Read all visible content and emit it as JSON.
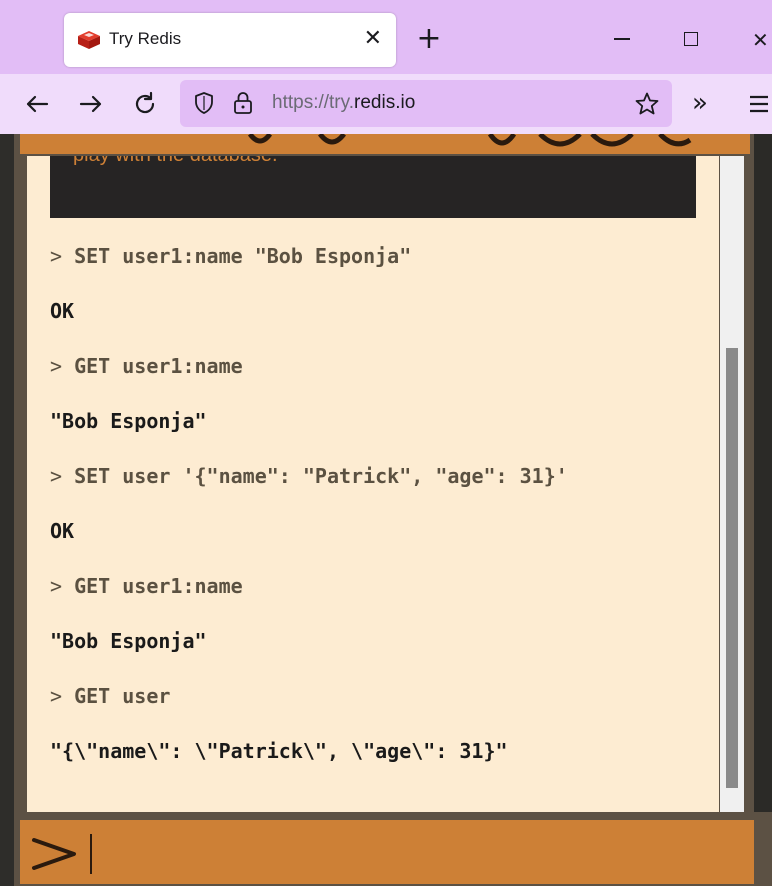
{
  "browser": {
    "tab": {
      "title": "Try Redis"
    },
    "url": {
      "prefix": "https://try.",
      "host": "redis.io"
    }
  },
  "console": {
    "intro_text": "play with the database.",
    "lines": [
      {
        "kind": "cmd",
        "text": "SET user1:name \"Bob Esponja\""
      },
      {
        "kind": "out",
        "text": "OK"
      },
      {
        "kind": "cmd",
        "text": "GET user1:name"
      },
      {
        "kind": "out",
        "text": "\"Bob Esponja\""
      },
      {
        "kind": "cmd",
        "text": "SET user '{\"name\": \"Patrick\", \"age\": 31}'"
      },
      {
        "kind": "out",
        "text": "OK"
      },
      {
        "kind": "cmd",
        "text": "GET user1:name"
      },
      {
        "kind": "out",
        "text": "\"Bob Esponja\""
      },
      {
        "kind": "cmd",
        "text": "GET user"
      },
      {
        "kind": "out",
        "text": "\"{\\\"name\\\": \\\"Patrick\\\", \\\"age\\\": 31}\""
      }
    ],
    "prompt_symbol": ">"
  },
  "input": {
    "value": ""
  },
  "colors": {
    "tabstrip": "#e2bdf6",
    "accent_orange": "#cd8036",
    "console_bg": "#fdecd2",
    "command_text": "#5b5141",
    "output_text": "#1a1a1a"
  },
  "icons": [
    "redis-logo-icon",
    "close-icon",
    "plus-icon",
    "minimize-icon",
    "maximize-icon",
    "back-arrow-icon",
    "forward-arrow-icon",
    "reload-icon",
    "shield-icon",
    "lock-icon",
    "star-icon",
    "chevrons-right-icon",
    "menu-icon",
    "prompt-chevron-icon"
  ]
}
